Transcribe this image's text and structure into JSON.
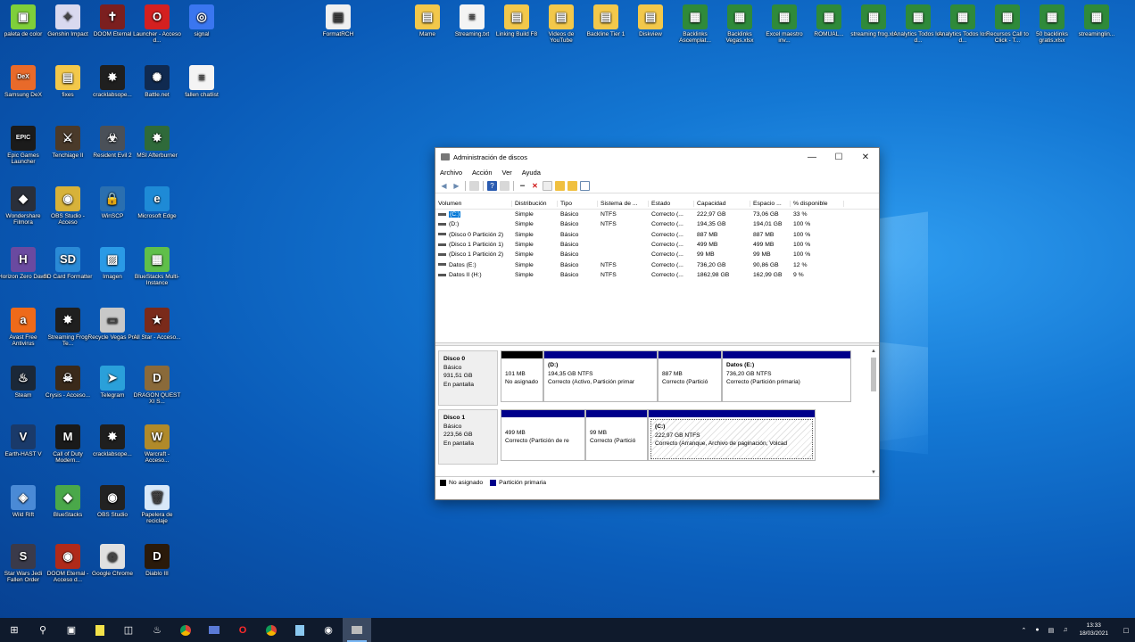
{
  "desktop": {
    "icons": [
      {
        "id": "i1",
        "label": "paleta de color",
        "color": "#7ecf3a",
        "glyph": "▣"
      },
      {
        "id": "i2",
        "label": "Genshin Impact",
        "color": "#d9d9ef",
        "glyph": "✦"
      },
      {
        "id": "i3",
        "label": "DOOM Eternal",
        "color": "#7b1f1f",
        "glyph": "✝"
      },
      {
        "id": "i4",
        "label": "Launcher - Acceso d...",
        "color": "#d42020",
        "glyph": "O"
      },
      {
        "id": "i5",
        "label": "signal",
        "color": "#3a76f0",
        "glyph": "◎"
      },
      {
        "id": "i6",
        "label": "Samsung DeX",
        "color": "#e86a2a",
        "glyph": "DeX"
      },
      {
        "id": "i7",
        "label": "fixes",
        "color": "#f2c84b",
        "glyph": "▤"
      },
      {
        "id": "i8",
        "label": "cracklabsope...",
        "color": "#1f1f1f",
        "glyph": "✸"
      },
      {
        "id": "i9",
        "label": "Battle.net",
        "color": "#102a50",
        "glyph": "✺"
      },
      {
        "id": "i10",
        "label": "fallen chatlist",
        "color": "#f4f4f4",
        "glyph": "≡"
      },
      {
        "id": "i11",
        "label": "Epic Games Launcher",
        "color": "#1b1b1b",
        "glyph": "EPIC"
      },
      {
        "id": "i12",
        "label": "Tenchiage II",
        "color": "#4a3a2a",
        "glyph": "⚔"
      },
      {
        "id": "i13",
        "label": "Resident Evil 2",
        "color": "#4a5058",
        "glyph": "☣"
      },
      {
        "id": "i14",
        "label": "MSI Afterburner",
        "color": "#2f6a3a",
        "glyph": "✸"
      },
      {
        "id": "i15",
        "label": "Wondershare Filmora",
        "color": "#2a2f3a",
        "glyph": "◆"
      },
      {
        "id": "i16",
        "label": "OBS Studio - Acceso",
        "color": "#d7b23a",
        "glyph": "◉"
      },
      {
        "id": "i17",
        "label": "WinSCP",
        "color": "#2a6fb0",
        "glyph": "🔒"
      },
      {
        "id": "i18",
        "label": "Microsoft Edge",
        "color": "#1e8ad6",
        "glyph": "e"
      },
      {
        "id": "i19",
        "label": "Horizon Zero Dawn",
        "color": "#6a4aa0",
        "glyph": "H"
      },
      {
        "id": "i20",
        "label": "SD Card Formatter",
        "color": "#2a8ad6",
        "glyph": "SD"
      },
      {
        "id": "i21",
        "label": "Imagen",
        "color": "#2a9ae6",
        "glyph": "▨"
      },
      {
        "id": "i22",
        "label": "BlueStacks Multi-Instance",
        "color": "#5fbf4a",
        "glyph": "▦"
      },
      {
        "id": "i23",
        "label": "Avast Free Antivirus",
        "color": "#ee6a1a",
        "glyph": "a"
      },
      {
        "id": "i24",
        "label": "Streaming Frog Te...",
        "color": "#1f1f1f",
        "glyph": "✸"
      },
      {
        "id": "i25",
        "label": "Recycle Vegas Pro",
        "color": "#c8c8c8",
        "glyph": "▭"
      },
      {
        "id": "i26",
        "label": "All Star - Acceso...",
        "color": "#7a2a1a",
        "glyph": "★"
      },
      {
        "id": "i27",
        "label": "Steam",
        "color": "#1b2838",
        "glyph": "♨"
      },
      {
        "id": "i28",
        "label": "Crysis - Acceso...",
        "color": "#3a2a1a",
        "glyph": "☠"
      },
      {
        "id": "i29",
        "label": "Telegram",
        "color": "#2aa0da",
        "glyph": "➤"
      },
      {
        "id": "i30",
        "label": "DRAGON QUEST XI S...",
        "color": "#8a6a3a",
        "glyph": "D"
      },
      {
        "id": "i31",
        "label": "Earth-HAST V",
        "color": "#1a3a6a",
        "glyph": "V"
      },
      {
        "id": "i32",
        "label": "Call of Duty Modern...",
        "color": "#1a1a1a",
        "glyph": "M"
      },
      {
        "id": "i33",
        "label": "cracklabsope...",
        "color": "#1f1f1f",
        "glyph": "✸"
      },
      {
        "id": "i34",
        "label": "Warcraft - Acceso...",
        "color": "#b08a2a",
        "glyph": "W"
      },
      {
        "id": "i35",
        "label": "Wild Rift",
        "color": "#4a8ad6",
        "glyph": "◈"
      },
      {
        "id": "i36",
        "label": "BlueStacks",
        "color": "#4aa84a",
        "glyph": "◆"
      },
      {
        "id": "i37",
        "label": "OBS Studio",
        "color": "#222",
        "glyph": "◉"
      },
      {
        "id": "i38",
        "label": "Papelera de reciclaje",
        "color": "#d8e8f8",
        "glyph": "🗑"
      },
      {
        "id": "i39",
        "label": "Star Wars Jedi Fallen Order",
        "color": "#3a3a4a",
        "glyph": "S"
      },
      {
        "id": "i40",
        "label": "DOOM Eternal - Acceso d...",
        "color": "#b02a1a",
        "glyph": "◉"
      },
      {
        "id": "i41",
        "label": "Google Chrome",
        "color": "#e0e0e0",
        "glyph": "◎"
      },
      {
        "id": "i42",
        "label": "Diablo III",
        "color": "#2a1a0a",
        "glyph": "D"
      },
      {
        "id": "t1",
        "label": "FormatRCH",
        "color": "#f0f0f0",
        "glyph": "▤"
      },
      {
        "id": "t2",
        "label": "Mame",
        "color": "#f2c84b",
        "glyph": "▤"
      },
      {
        "id": "t3",
        "label": "Streaming.txt",
        "color": "#f4f4f4",
        "glyph": "≡"
      },
      {
        "id": "t4",
        "label": "Linking Build F8",
        "color": "#f2c84b",
        "glyph": "▤"
      },
      {
        "id": "t5",
        "label": "Videos de YouTube",
        "color": "#f2c84b",
        "glyph": "▤"
      },
      {
        "id": "t6",
        "label": "Backline Tier 1",
        "color": "#f2c84b",
        "glyph": "▤"
      },
      {
        "id": "t7",
        "label": "Diskview",
        "color": "#f2c84b",
        "glyph": "▤"
      },
      {
        "id": "t8",
        "label": "Backlinks Ascemplat...",
        "color": "#2f8a3a",
        "glyph": "▦"
      },
      {
        "id": "t9",
        "label": "Backlinks Vegas.xlsx",
        "color": "#2f8a3a",
        "glyph": "▦"
      },
      {
        "id": "t10",
        "label": "Excel maestro inv...",
        "color": "#2f8a3a",
        "glyph": "▦"
      },
      {
        "id": "t11",
        "label": "ROMUAL...",
        "color": "#2f8a3a",
        "glyph": "▦"
      },
      {
        "id": "t12",
        "label": "streaming frog.xls",
        "color": "#2f8a3a",
        "glyph": "▦"
      },
      {
        "id": "t13",
        "label": "Analytics Todos los d...",
        "color": "#2f8a3a",
        "glyph": "▦"
      },
      {
        "id": "t14",
        "label": "Analytics Todos los d...",
        "color": "#2f8a3a",
        "glyph": "▦"
      },
      {
        "id": "t15",
        "label": "Recursos Call to Click - T...",
        "color": "#2f8a3a",
        "glyph": "▦"
      },
      {
        "id": "t16",
        "label": "50 backlinks gratis.xlsx",
        "color": "#2f8a3a",
        "glyph": "▦"
      },
      {
        "id": "t17",
        "label": "streaminglin...",
        "color": "#2f8a3a",
        "glyph": "▦"
      }
    ]
  },
  "window": {
    "title": "Administración de discos",
    "menu": [
      "Archivo",
      "Acción",
      "Ver",
      "Ayuda"
    ],
    "columns": [
      "Volumen",
      "Distribución",
      "Tipo",
      "Sistema de ...",
      "Estado",
      "Capacidad",
      "Espacio ...",
      "% disponible"
    ],
    "volumes": [
      [
        "(C:)",
        "Simple",
        "Básico",
        "NTFS",
        "Correcto (...",
        "222,97 GB",
        "73,06 GB",
        "33 %"
      ],
      [
        "(D:)",
        "Simple",
        "Básico",
        "NTFS",
        "Correcto (...",
        "194,35 GB",
        "194,01 GB",
        "100 %"
      ],
      [
        "(Disco 0 Partición 2)",
        "Simple",
        "Básico",
        "",
        "Correcto (...",
        "887 MB",
        "887 MB",
        "100 %"
      ],
      [
        "(Disco 1 Partición 1)",
        "Simple",
        "Básico",
        "",
        "Correcto (...",
        "499 MB",
        "499 MB",
        "100 %"
      ],
      [
        "(Disco 1 Partición 2)",
        "Simple",
        "Básico",
        "",
        "Correcto (...",
        "99 MB",
        "99 MB",
        "100 %"
      ],
      [
        "Datos (E:)",
        "Simple",
        "Básico",
        "NTFS",
        "Correcto (...",
        "736,20 GB",
        "90,86 GB",
        "12 %"
      ],
      [
        "Datos II (H:)",
        "Simple",
        "Básico",
        "NTFS",
        "Correcto (...",
        "1862,98 GB",
        "162,99 GB",
        "9 %"
      ]
    ],
    "disks": [
      {
        "name": "Disco 0",
        "type": "Básico",
        "size": "931,51 GB",
        "status": "En pantalla",
        "partitions": [
          {
            "name": "",
            "size": "101 MB",
            "desc": "No asignado",
            "kind": "unalloc"
          },
          {
            "name": "(D:)",
            "size": "194,35 GB NTFS",
            "desc": "Correcto (Activo, Partición primar",
            "kind": "primary"
          },
          {
            "name": "",
            "size": "887 MB",
            "desc": "Correcto (Partició",
            "kind": "primary"
          },
          {
            "name": "Datos (E:)",
            "size": "736,20 GB NTFS",
            "desc": "Correcto (Partición primaria)",
            "kind": "primary"
          }
        ]
      },
      {
        "name": "Disco 1",
        "type": "Básico",
        "size": "223,56 GB",
        "status": "En pantalla",
        "partitions": [
          {
            "name": "",
            "size": "499 MB",
            "desc": "Correcto (Partición de re",
            "kind": "primary"
          },
          {
            "name": "",
            "size": "99 MB",
            "desc": "Correcto (Partició",
            "kind": "primary"
          },
          {
            "name": "(C:)",
            "size": "222,97 GB NTFS",
            "desc": "Correcto (Arranque, Archivo de paginación, Volcad",
            "kind": "hatched"
          }
        ]
      }
    ],
    "legend": {
      "unallocated": "No asignado",
      "primary": "Partición primaria"
    },
    "colors": {
      "primary": "#00008b",
      "unallocated": "#000000",
      "selection": "#0078d7"
    }
  },
  "taskbar": {
    "time": "13:33",
    "date": "18/03/2021",
    "apps": [
      "start-icon",
      "search-icon",
      "task-view-icon",
      "sticky-notes-icon",
      "store-icon",
      "steam-icon",
      "chrome-icon",
      "display-icon",
      "opera-icon",
      "chrome-alt-icon",
      "files-icon",
      "obs-icon",
      "disk-management-icon"
    ]
  }
}
